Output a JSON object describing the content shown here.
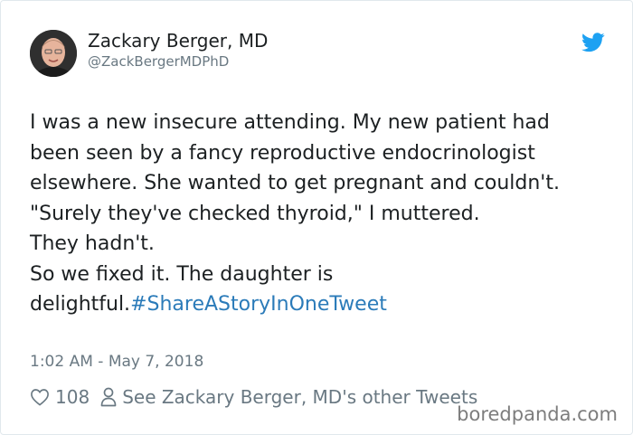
{
  "author": {
    "display_name": "Zackary Berger, MD",
    "handle": "@ZackBergerMDPhD",
    "avatar_icon": "avatar-photo",
    "platform_icon": "twitter-bird-icon",
    "platform_color": "#1da1f2"
  },
  "tweet": {
    "text": "I was a new insecure attending. My new patient had been seen by a fancy reproductive endocrinologist elsewhere. She wanted to get pregnant and couldn't.\n\"Surely they've checked thyroid,\" I muttered.\nThey hadn't.\nSo we fixed it. The daughter is delightful.",
    "hashtag": "#ShareAStoryInOneTweet",
    "hashtag_color": "#2b7bb9",
    "timestamp": "1:02 AM - May 7, 2018"
  },
  "actions": {
    "like_icon": "heart-icon",
    "like_count": "108",
    "profile_icon": "person-icon",
    "profile_link_label": "See Zackary Berger, MD's other Tweets"
  },
  "watermark": "boredpanda.com"
}
